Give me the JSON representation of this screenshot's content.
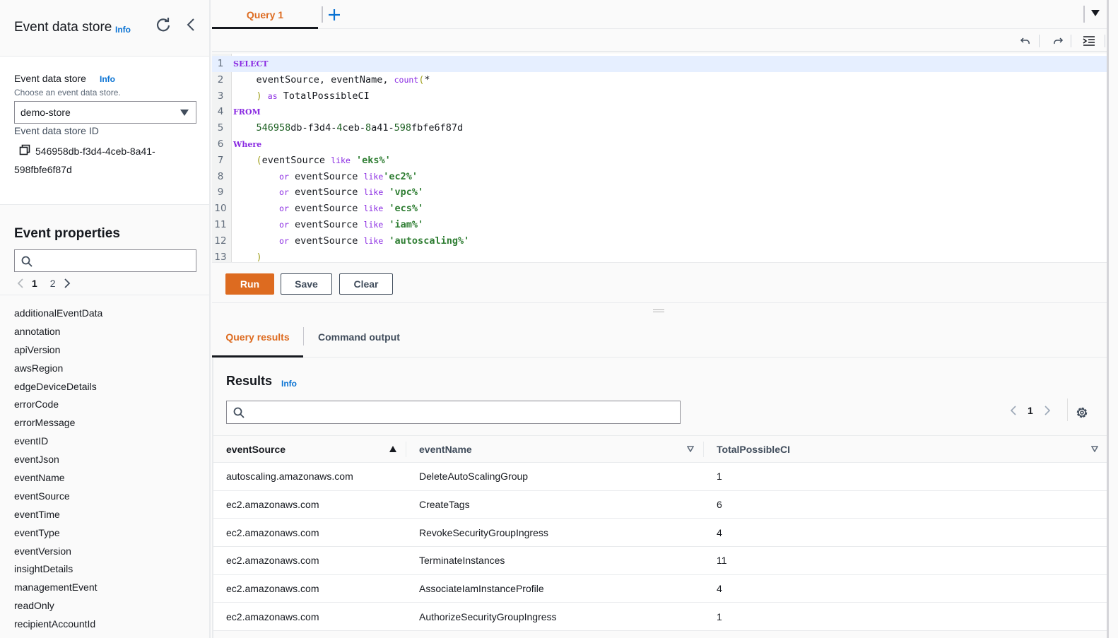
{
  "sidebar": {
    "title": "Event data store",
    "title_info": "Info",
    "store_label": "Event data store",
    "store_info": "Info",
    "store_hint": "Choose an event data store.",
    "store_selected": "demo-store",
    "store_id_label": "Event data store ID",
    "store_id_value": "546958db-f3d4-4ceb-8a41-598fbfe6f87d",
    "properties_title": "Event properties",
    "properties_search_placeholder": "",
    "pages": [
      "1",
      "2"
    ],
    "current_page": "1",
    "properties": [
      "additionalEventData",
      "annotation",
      "apiVersion",
      "awsRegion",
      "edgeDeviceDetails",
      "errorCode",
      "errorMessage",
      "eventID",
      "eventJson",
      "eventName",
      "eventSource",
      "eventTime",
      "eventType",
      "eventVersion",
      "insightDetails",
      "managementEvent",
      "readOnly",
      "recipientAccountId"
    ]
  },
  "editor": {
    "tabs": [
      {
        "label": "Query 1",
        "active": true
      }
    ],
    "line_numbers": [
      "1",
      "2",
      "3",
      "4",
      "5",
      "6",
      "7",
      "8",
      "9",
      "10",
      "11",
      "12",
      "13"
    ],
    "code": {
      "l1_kw": "SELECT",
      "l2_text": "eventSource, eventName, ",
      "l2_fn": "count",
      "l2_paren": "(",
      "l2_star": "*",
      "l3_paren": ")",
      "l3_kw": "as",
      "l3_text": "TotalPossibleCI",
      "l4_kw": "FROM",
      "l5_a": "546958",
      "l5_b": "db-f3d4-",
      "l5_c": "4",
      "l5_d": "ceb-",
      "l5_e": "8",
      "l5_f": "a41-",
      "l5_g": "598",
      "l5_h": "fbfe6f87d",
      "l6_kw": "Where",
      "l7_paren": "(",
      "l7_text": "eventSource ",
      "like": "like",
      "or": "or",
      "field": "eventSource",
      "s_eks": "'eks%'",
      "s_ec2": "'ec2%'",
      "s_vpc": "'vpc%'",
      "s_ecs": "'ecs%'",
      "s_iam": "'iam%'",
      "s_autoscaling": "'autoscaling%'",
      "l13_paren": ")"
    }
  },
  "actions": {
    "run": "Run",
    "save": "Save",
    "clear": "Clear"
  },
  "result_tabs": {
    "results": "Query results",
    "command": "Command output"
  },
  "results": {
    "title": "Results",
    "info": "Info",
    "search_placeholder": "",
    "page": "1",
    "columns": [
      "eventSource",
      "eventName",
      "TotalPossibleCI"
    ],
    "rows": [
      [
        "autoscaling.amazonaws.com",
        "DeleteAutoScalingGroup",
        "1"
      ],
      [
        "ec2.amazonaws.com",
        "CreateTags",
        "6"
      ],
      [
        "ec2.amazonaws.com",
        "RevokeSecurityGroupIngress",
        "4"
      ],
      [
        "ec2.amazonaws.com",
        "TerminateInstances",
        "11"
      ],
      [
        "ec2.amazonaws.com",
        "AssociateIamInstanceProfile",
        "4"
      ],
      [
        "ec2.amazonaws.com",
        "AuthorizeSecurityGroupIngress",
        "1"
      ]
    ]
  },
  "colors": {
    "accent_orange": "#dd6b20",
    "link_blue": "#0972d3",
    "keyword_purple": "#8a2be2",
    "string_green": "#2e7d32"
  }
}
